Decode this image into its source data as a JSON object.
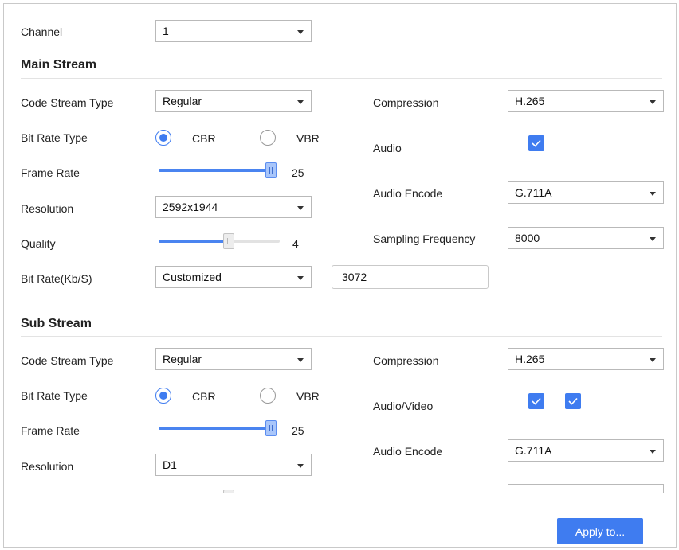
{
  "channel": {
    "label": "Channel",
    "value": "1"
  },
  "main_stream": {
    "title": "Main Stream",
    "code_stream_type": {
      "label": "Code Stream Type",
      "value": "Regular"
    },
    "bit_rate_type": {
      "label": "Bit Rate Type",
      "options": [
        "CBR",
        "VBR"
      ],
      "selected": "CBR"
    },
    "frame_rate": {
      "label": "Frame Rate",
      "value": "25",
      "level": 1.0
    },
    "resolution": {
      "label": "Resolution",
      "value": "2592x1944"
    },
    "quality": {
      "label": "Quality",
      "value": "4",
      "level": 0.6
    },
    "bit_rate": {
      "label": "Bit Rate(Kb/S)",
      "mode": "Customized",
      "value": "3072"
    },
    "compression": {
      "label": "Compression",
      "value": "H.265"
    },
    "audio": {
      "label": "Audio",
      "checked": true
    },
    "audio_encode": {
      "label": "Audio Encode",
      "value": "G.711A"
    },
    "sampling_frequency": {
      "label": "Sampling Frequency",
      "value": "8000"
    }
  },
  "sub_stream": {
    "title": "Sub Stream",
    "code_stream_type": {
      "label": "Code Stream Type",
      "value": "Regular"
    },
    "bit_rate_type": {
      "label": "Bit Rate Type",
      "options": [
        "CBR",
        "VBR"
      ],
      "selected": "CBR"
    },
    "frame_rate": {
      "label": "Frame Rate",
      "value": "25",
      "level": 1.0
    },
    "resolution": {
      "label": "Resolution",
      "value": "D1"
    },
    "compression": {
      "label": "Compression",
      "value": "H.265"
    },
    "audio_video": {
      "label": "Audio/Video",
      "audio_checked": true,
      "video_checked": true
    },
    "audio_encode": {
      "label": "Audio Encode",
      "value": "G.711A"
    }
  },
  "footer": {
    "apply_label": "Apply to..."
  },
  "colors": {
    "accent": "#3f7cf0",
    "slider_fill": "#4a84f0",
    "border": "#b9b9b9"
  },
  "icons": {
    "dropdown": "chevron-down-icon",
    "check": "checkmark-icon"
  }
}
